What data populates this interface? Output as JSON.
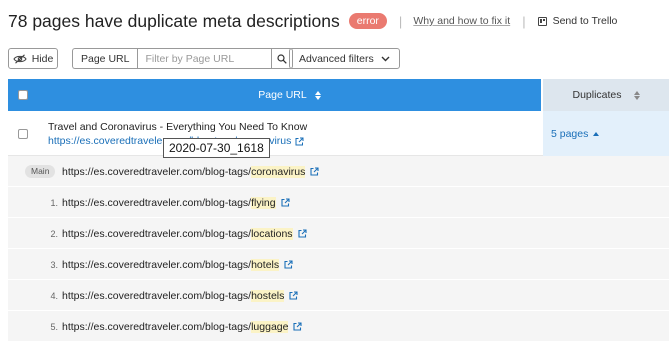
{
  "header": {
    "title": "78 pages have duplicate meta descriptions",
    "badge": "error",
    "separator": "|",
    "fix_link": "Why and how to fix it",
    "trello": "Send to Trello"
  },
  "toolbar": {
    "hide_label": "Hide",
    "filter_label": "Page URL",
    "filter_placeholder": "Filter by Page URL",
    "advanced_filters": "Advanced filters"
  },
  "table": {
    "col_url": "Page URL",
    "col_duplicates": "Duplicates",
    "row": {
      "title": "Travel and Coronavirus - Everything You Need To Know",
      "url": "https://es.coveredtraveler.com/blog-tags/coronavirus",
      "duplicates": "5 pages"
    },
    "tooltip": "2020-07-30_1618",
    "main_label": "Main",
    "url_prefix": "https://es.coveredtraveler.com/blog-tags/",
    "details": [
      {
        "num": "",
        "slug": "coronavirus"
      },
      {
        "num": "1.",
        "slug": "flying"
      },
      {
        "num": "2.",
        "slug": "locations"
      },
      {
        "num": "3.",
        "slug": "hotels"
      },
      {
        "num": "4.",
        "slug": "hostels"
      },
      {
        "num": "5.",
        "slug": "luggage"
      }
    ]
  },
  "colors": {
    "accent": "#2e8fe0",
    "link": "#1a6fb8",
    "error_badge": "#ea7a70",
    "highlight": "#fbf3c6"
  }
}
